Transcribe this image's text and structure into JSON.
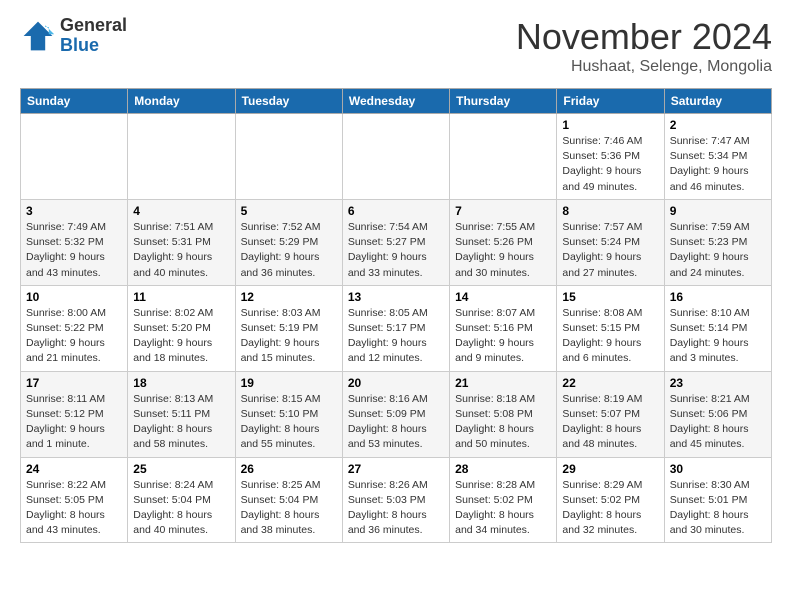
{
  "logo": {
    "general": "General",
    "blue": "Blue"
  },
  "header": {
    "month": "November 2024",
    "location": "Hushaat, Selenge, Mongolia"
  },
  "weekdays": [
    "Sunday",
    "Monday",
    "Tuesday",
    "Wednesday",
    "Thursday",
    "Friday",
    "Saturday"
  ],
  "weeks": [
    [
      {
        "day": "",
        "info": ""
      },
      {
        "day": "",
        "info": ""
      },
      {
        "day": "",
        "info": ""
      },
      {
        "day": "",
        "info": ""
      },
      {
        "day": "",
        "info": ""
      },
      {
        "day": "1",
        "info": "Sunrise: 7:46 AM\nSunset: 5:36 PM\nDaylight: 9 hours and 49 minutes."
      },
      {
        "day": "2",
        "info": "Sunrise: 7:47 AM\nSunset: 5:34 PM\nDaylight: 9 hours and 46 minutes."
      }
    ],
    [
      {
        "day": "3",
        "info": "Sunrise: 7:49 AM\nSunset: 5:32 PM\nDaylight: 9 hours and 43 minutes."
      },
      {
        "day": "4",
        "info": "Sunrise: 7:51 AM\nSunset: 5:31 PM\nDaylight: 9 hours and 40 minutes."
      },
      {
        "day": "5",
        "info": "Sunrise: 7:52 AM\nSunset: 5:29 PM\nDaylight: 9 hours and 36 minutes."
      },
      {
        "day": "6",
        "info": "Sunrise: 7:54 AM\nSunset: 5:27 PM\nDaylight: 9 hours and 33 minutes."
      },
      {
        "day": "7",
        "info": "Sunrise: 7:55 AM\nSunset: 5:26 PM\nDaylight: 9 hours and 30 minutes."
      },
      {
        "day": "8",
        "info": "Sunrise: 7:57 AM\nSunset: 5:24 PM\nDaylight: 9 hours and 27 minutes."
      },
      {
        "day": "9",
        "info": "Sunrise: 7:59 AM\nSunset: 5:23 PM\nDaylight: 9 hours and 24 minutes."
      }
    ],
    [
      {
        "day": "10",
        "info": "Sunrise: 8:00 AM\nSunset: 5:22 PM\nDaylight: 9 hours and 21 minutes."
      },
      {
        "day": "11",
        "info": "Sunrise: 8:02 AM\nSunset: 5:20 PM\nDaylight: 9 hours and 18 minutes."
      },
      {
        "day": "12",
        "info": "Sunrise: 8:03 AM\nSunset: 5:19 PM\nDaylight: 9 hours and 15 minutes."
      },
      {
        "day": "13",
        "info": "Sunrise: 8:05 AM\nSunset: 5:17 PM\nDaylight: 9 hours and 12 minutes."
      },
      {
        "day": "14",
        "info": "Sunrise: 8:07 AM\nSunset: 5:16 PM\nDaylight: 9 hours and 9 minutes."
      },
      {
        "day": "15",
        "info": "Sunrise: 8:08 AM\nSunset: 5:15 PM\nDaylight: 9 hours and 6 minutes."
      },
      {
        "day": "16",
        "info": "Sunrise: 8:10 AM\nSunset: 5:14 PM\nDaylight: 9 hours and 3 minutes."
      }
    ],
    [
      {
        "day": "17",
        "info": "Sunrise: 8:11 AM\nSunset: 5:12 PM\nDaylight: 9 hours and 1 minute."
      },
      {
        "day": "18",
        "info": "Sunrise: 8:13 AM\nSunset: 5:11 PM\nDaylight: 8 hours and 58 minutes."
      },
      {
        "day": "19",
        "info": "Sunrise: 8:15 AM\nSunset: 5:10 PM\nDaylight: 8 hours and 55 minutes."
      },
      {
        "day": "20",
        "info": "Sunrise: 8:16 AM\nSunset: 5:09 PM\nDaylight: 8 hours and 53 minutes."
      },
      {
        "day": "21",
        "info": "Sunrise: 8:18 AM\nSunset: 5:08 PM\nDaylight: 8 hours and 50 minutes."
      },
      {
        "day": "22",
        "info": "Sunrise: 8:19 AM\nSunset: 5:07 PM\nDaylight: 8 hours and 48 minutes."
      },
      {
        "day": "23",
        "info": "Sunrise: 8:21 AM\nSunset: 5:06 PM\nDaylight: 8 hours and 45 minutes."
      }
    ],
    [
      {
        "day": "24",
        "info": "Sunrise: 8:22 AM\nSunset: 5:05 PM\nDaylight: 8 hours and 43 minutes."
      },
      {
        "day": "25",
        "info": "Sunrise: 8:24 AM\nSunset: 5:04 PM\nDaylight: 8 hours and 40 minutes."
      },
      {
        "day": "26",
        "info": "Sunrise: 8:25 AM\nSunset: 5:04 PM\nDaylight: 8 hours and 38 minutes."
      },
      {
        "day": "27",
        "info": "Sunrise: 8:26 AM\nSunset: 5:03 PM\nDaylight: 8 hours and 36 minutes."
      },
      {
        "day": "28",
        "info": "Sunrise: 8:28 AM\nSunset: 5:02 PM\nDaylight: 8 hours and 34 minutes."
      },
      {
        "day": "29",
        "info": "Sunrise: 8:29 AM\nSunset: 5:02 PM\nDaylight: 8 hours and 32 minutes."
      },
      {
        "day": "30",
        "info": "Sunrise: 8:30 AM\nSunset: 5:01 PM\nDaylight: 8 hours and 30 minutes."
      }
    ]
  ]
}
